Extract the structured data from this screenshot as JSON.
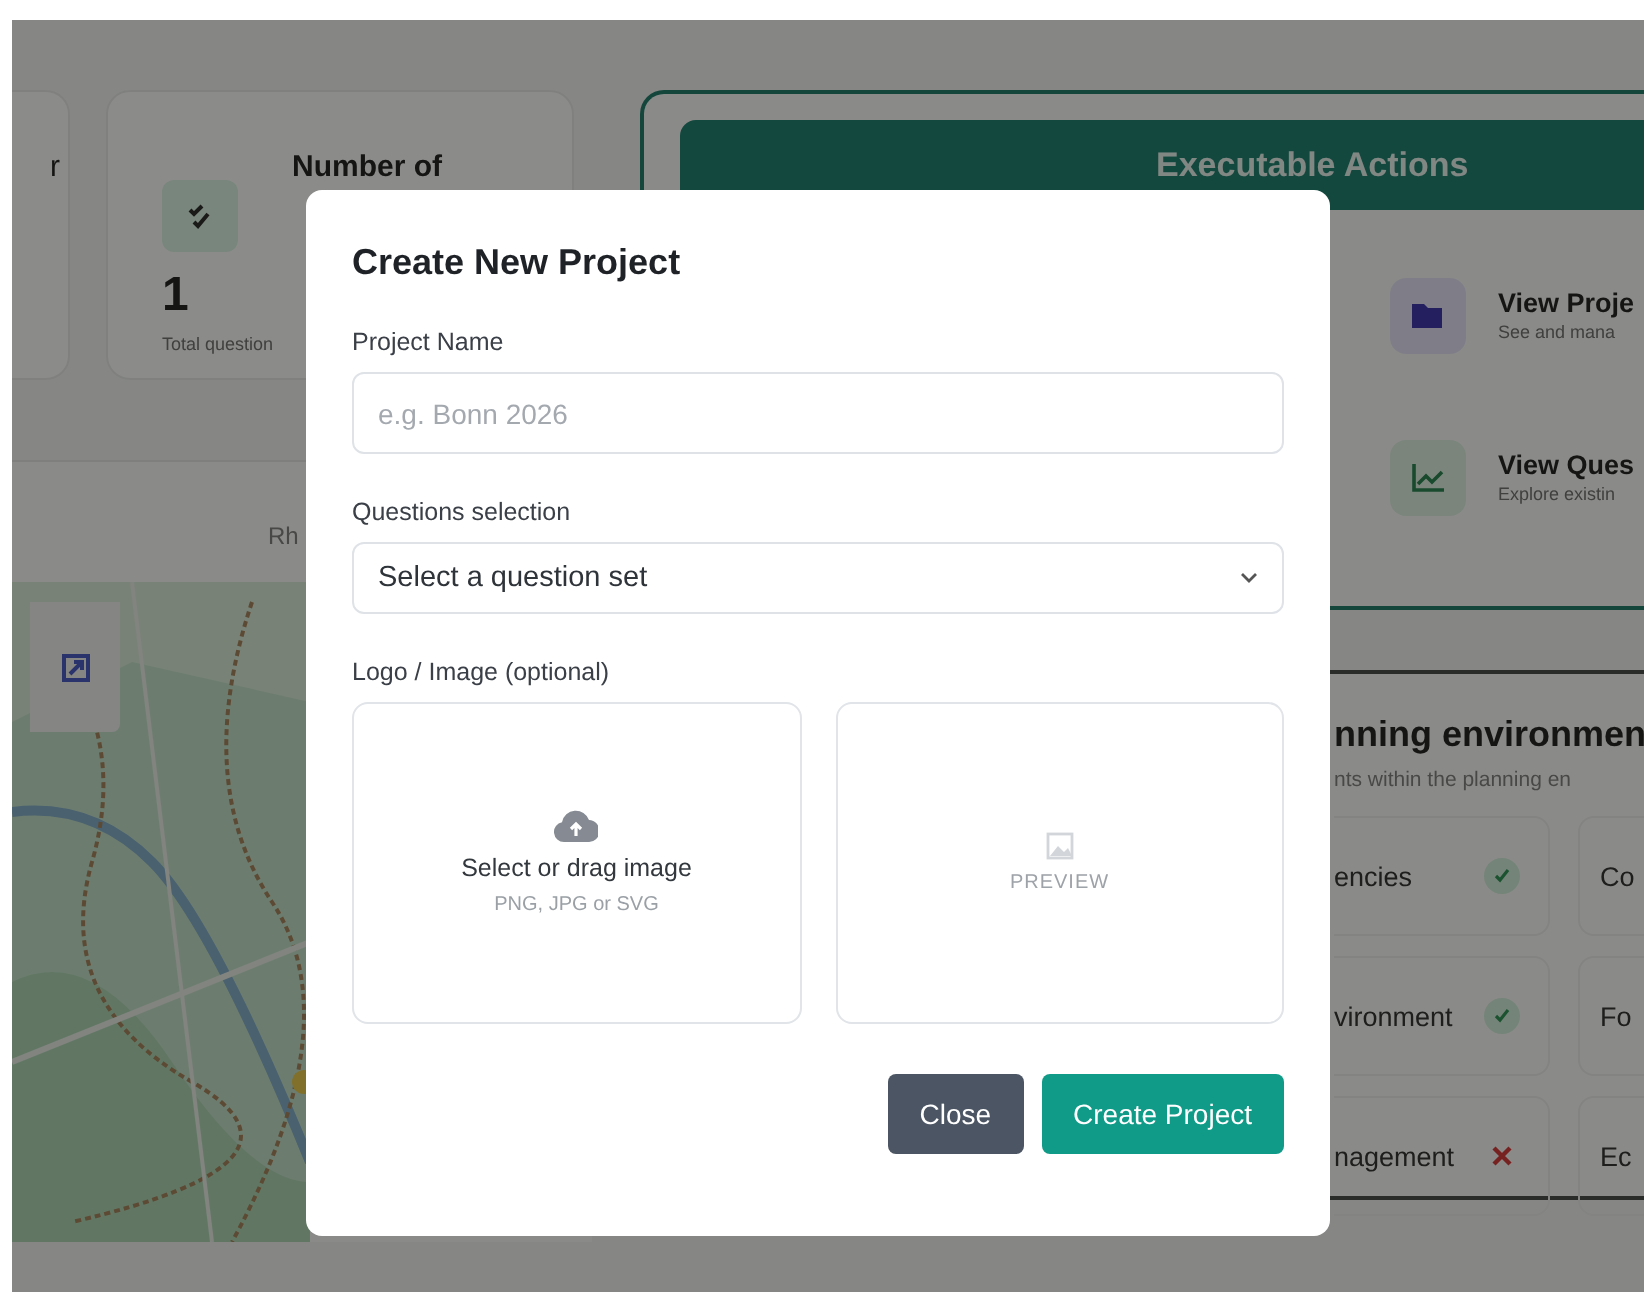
{
  "background": {
    "stat_cards": [
      {
        "title": "r"
      },
      {
        "title": "Number of",
        "value": "1",
        "caption": "Total question"
      }
    ],
    "map_panel": {
      "header": "Rh"
    },
    "actions_panel": {
      "title": "Executable Actions",
      "items": [
        {
          "kind": "folder",
          "title": "View Proje",
          "subtitle": "See and mana"
        },
        {
          "kind": "chart",
          "title": "View Ques",
          "subtitle": "Explore existin"
        }
      ]
    },
    "environment_panel": {
      "title": "nning environmen",
      "subtitle": "nts within the planning en",
      "items": [
        {
          "label": "encies",
          "done": true
        },
        {
          "label": "Co"
        },
        {
          "label": "vironment",
          "done": true
        },
        {
          "label": "Fo"
        },
        {
          "label": "nagement",
          "done": false
        },
        {
          "label": "Ec"
        }
      ]
    }
  },
  "modal": {
    "title": "Create New Project",
    "fields": [
      {
        "kind": "text",
        "label": "Project Name",
        "placeholder": "e.g. Bonn 2026"
      },
      {
        "kind": "select",
        "label": "Questions selection",
        "value": "Select a question set"
      }
    ],
    "upload": {
      "label": "Logo / Image (optional)",
      "prompt": "Select or drag image",
      "formats": "PNG, JPG or SVG",
      "preview_label": "PREVIEW"
    },
    "buttons": [
      {
        "kind": "secondary",
        "label": "Close"
      },
      {
        "kind": "primary",
        "label": "Create Project"
      }
    ]
  }
}
